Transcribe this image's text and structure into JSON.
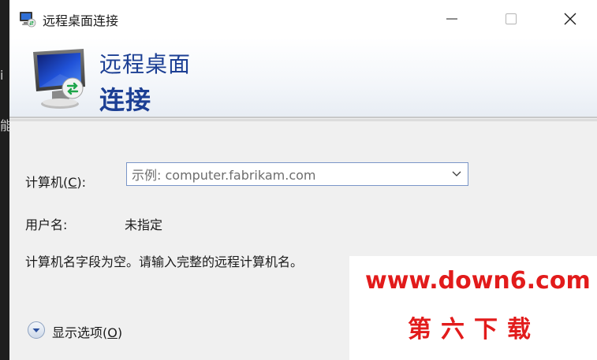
{
  "background": {
    "glyph_1": "i",
    "glyph_2": "能"
  },
  "window": {
    "title": "远程桌面连接",
    "controls": {
      "minimize_icon": "minimize-icon",
      "maximize_icon": "maximize-icon",
      "close_icon": "close-icon"
    }
  },
  "banner": {
    "line1": "远程桌面",
    "line2": "连接",
    "icon": "remote-desktop-monitor-icon",
    "text_color": "#1c3f94"
  },
  "form": {
    "computer_label_prefix": "计算机(",
    "computer_label_accel": "C",
    "computer_label_suffix": "):",
    "computer_placeholder": "示例: computer.fabrikam.com",
    "computer_value": "",
    "username_label": "用户名:",
    "username_value": "未指定",
    "message": "计算机名字段为空。请输入完整的远程计算机名。"
  },
  "options": {
    "label_prefix": "显示选项(",
    "label_accel": "O",
    "label_suffix": ")",
    "icon": "expand-down-icon"
  },
  "watermark": {
    "line1": "www.down6.com",
    "line2": "第六下载",
    "color": "#e21b1b"
  }
}
